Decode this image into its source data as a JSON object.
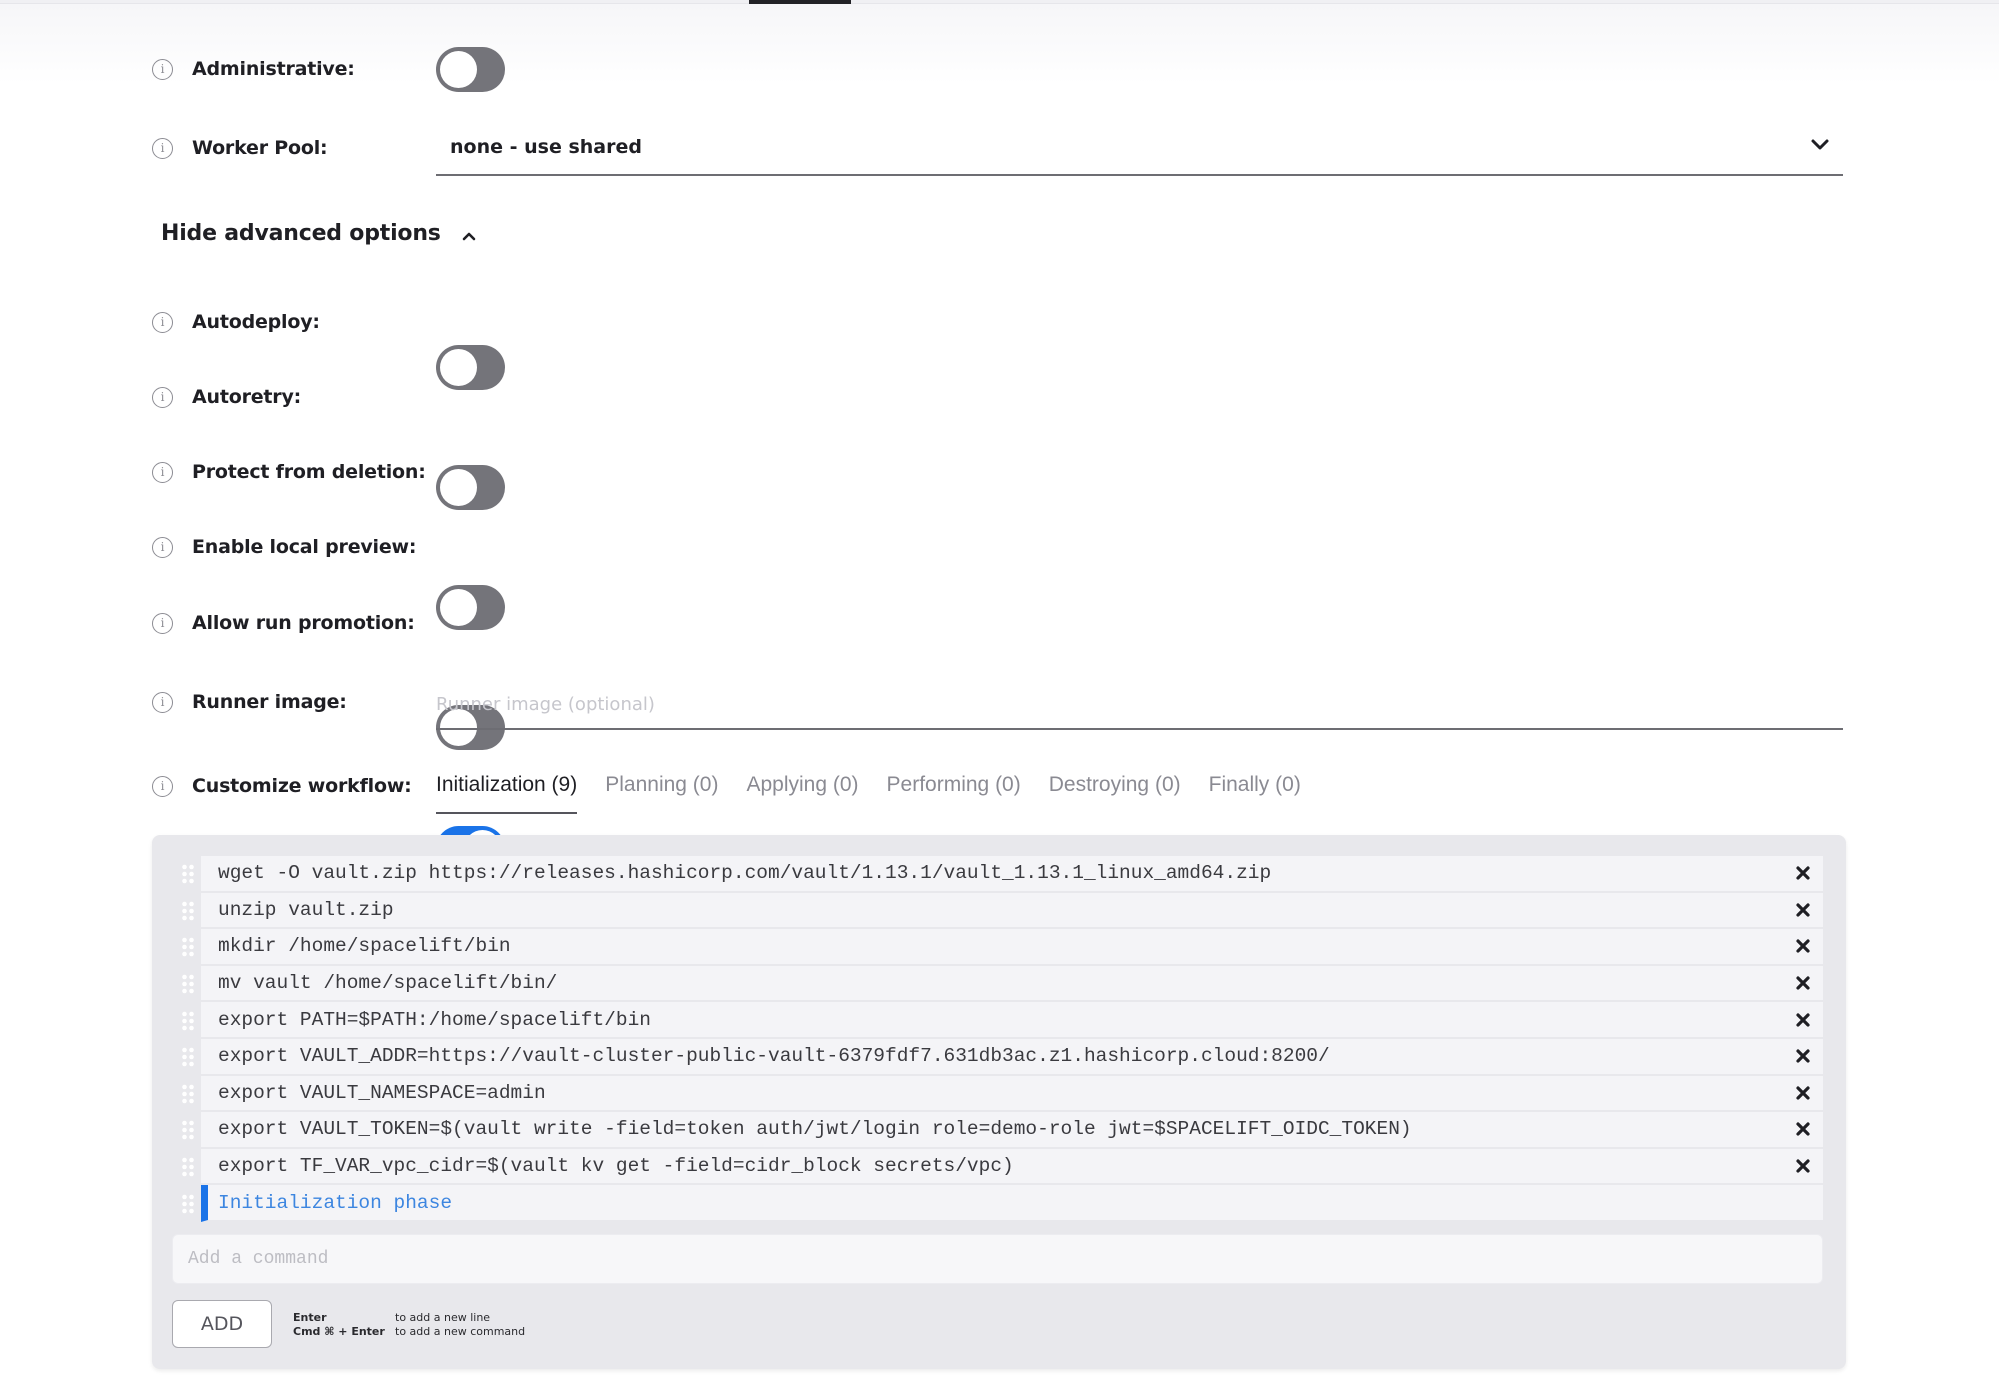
{
  "top_tab_bar": {
    "active_indicator": true
  },
  "settings": {
    "administrative": {
      "label": "Administrative:",
      "enabled": false
    },
    "worker_pool": {
      "label": "Worker Pool:",
      "value": "none - use shared"
    },
    "advanced_toggle": {
      "label": "Hide advanced options",
      "expanded": true
    },
    "autodeploy": {
      "label": "Autodeploy:",
      "enabled": false
    },
    "autoretry": {
      "label": "Autoretry:",
      "enabled": false
    },
    "protect_from_deletion": {
      "label": "Protect from deletion:",
      "enabled": false
    },
    "enable_local_preview": {
      "label": "Enable local preview:",
      "enabled": false
    },
    "allow_run_promotion": {
      "label": "Allow run promotion:",
      "enabled": true
    },
    "runner_image": {
      "label": "Runner image:",
      "value": "",
      "placeholder": "Runner image (optional)"
    },
    "customize_workflow": {
      "label": "Customize workflow:"
    }
  },
  "workflow_tabs": [
    {
      "label": "Initialization (9)",
      "active": true
    },
    {
      "label": "Planning (0)",
      "active": false
    },
    {
      "label": "Applying (0)",
      "active": false
    },
    {
      "label": "Performing (0)",
      "active": false
    },
    {
      "label": "Destroying (0)",
      "active": false
    },
    {
      "label": "Finally (0)",
      "active": false
    }
  ],
  "commands": [
    "wget -O vault.zip https://releases.hashicorp.com/vault/1.13.1/vault_1.13.1_linux_amd64.zip",
    "unzip vault.zip",
    "mkdir /home/spacelift/bin",
    "mv vault /home/spacelift/bin/",
    "export PATH=$PATH:/home/spacelift/bin",
    "export VAULT_ADDR=https://vault-cluster-public-vault-6379fdf7.631db3ac.z1.hashicorp.cloud:8200/",
    "export VAULT_NAMESPACE=admin",
    "export VAULT_TOKEN=$(vault write -field=token auth/jwt/login role=demo-role jwt=$SPACELIFT_OIDC_TOKEN)",
    "export TF_VAR_vpc_cidr=$(vault kv get -field=cidr_block secrets/vpc)"
  ],
  "editing_row": {
    "text": "Initialization phase"
  },
  "add_command": {
    "placeholder": "Add a command",
    "value": "",
    "button_label": "ADD",
    "hints": [
      {
        "key": "Enter",
        "action": "to add a new line"
      },
      {
        "key": "Cmd ⌘ + Enter",
        "action": "to add a new command"
      }
    ]
  },
  "colors": {
    "accent": "#1a73e8",
    "toggle_off": "#74747a",
    "panel_bg": "#e8e8ec",
    "row_bg": "#f4f4f7"
  }
}
